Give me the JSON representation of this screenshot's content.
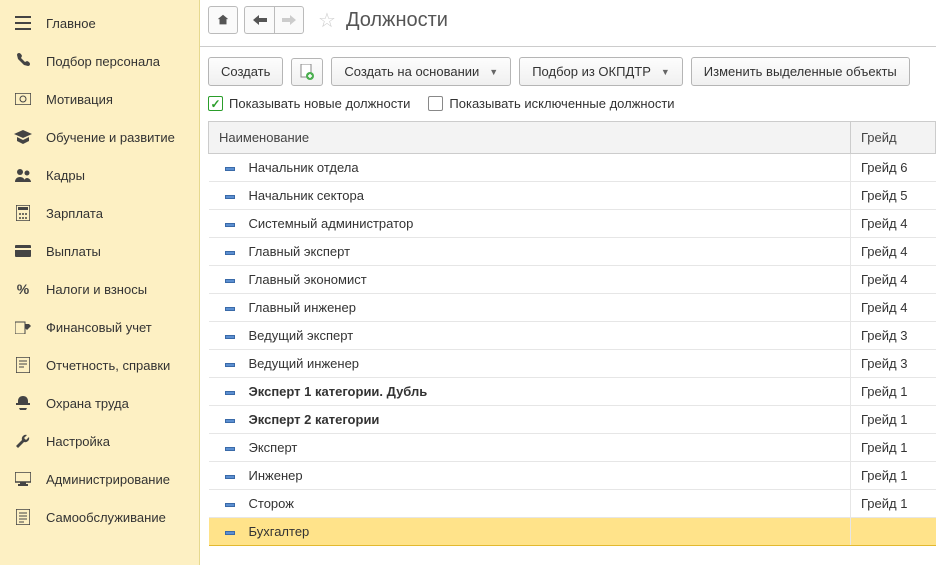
{
  "sidebar": {
    "items": [
      {
        "label": "Главное",
        "icon": "menu"
      },
      {
        "label": "Подбор персонала",
        "icon": "phone"
      },
      {
        "label": "Мотивация",
        "icon": "money"
      },
      {
        "label": "Обучение и развитие",
        "icon": "grad"
      },
      {
        "label": "Кадры",
        "icon": "users"
      },
      {
        "label": "Зарплата",
        "icon": "calc"
      },
      {
        "label": "Выплаты",
        "icon": "wallet"
      },
      {
        "label": "Налоги и взносы",
        "icon": "percent"
      },
      {
        "label": "Финансовый учет",
        "icon": "finance"
      },
      {
        "label": "Отчетность, справки",
        "icon": "report"
      },
      {
        "label": "Охрана труда",
        "icon": "safety"
      },
      {
        "label": "Настройка",
        "icon": "wrench"
      },
      {
        "label": "Администрирование",
        "icon": "admin"
      },
      {
        "label": "Самообслуживание",
        "icon": "self"
      }
    ]
  },
  "header": {
    "title": "Должности"
  },
  "toolbar": {
    "create": "Создать",
    "create_based": "Создать на основании",
    "pick": "Подбор из ОКПДТР",
    "change": "Изменить выделенные объекты"
  },
  "checkboxes": {
    "show_new": {
      "label": "Показывать новые должности",
      "checked": true
    },
    "show_excluded": {
      "label": "Показывать исключенные должности",
      "checked": false
    }
  },
  "table": {
    "columns": {
      "name": "Наименование",
      "grade": "Грейд"
    },
    "rows": [
      {
        "name": "Начальник отдела",
        "grade": "Грейд 6",
        "bold": false
      },
      {
        "name": "Начальник сектора",
        "grade": "Грейд 5",
        "bold": false
      },
      {
        "name": "Системный администратор",
        "grade": "Грейд 4",
        "bold": false
      },
      {
        "name": "Главный эксперт",
        "grade": "Грейд 4",
        "bold": false
      },
      {
        "name": "Главный экономист",
        "grade": "Грейд 4",
        "bold": false
      },
      {
        "name": "Главный инженер",
        "grade": "Грейд 4",
        "bold": false
      },
      {
        "name": "Ведущий эксперт",
        "grade": "Грейд 3",
        "bold": false
      },
      {
        "name": "Ведущий инженер",
        "grade": "Грейд 3",
        "bold": false
      },
      {
        "name": "Эксперт 1 категории. Дубль",
        "grade": "Грейд 1",
        "bold": true
      },
      {
        "name": "Эксперт 2 категории",
        "grade": "Грейд 1",
        "bold": true
      },
      {
        "name": "Эксперт",
        "grade": "Грейд 1",
        "bold": false
      },
      {
        "name": "Инженер",
        "grade": "Грейд 1",
        "bold": false
      },
      {
        "name": "Сторож",
        "grade": "Грейд 1",
        "bold": false
      },
      {
        "name": "Бухгалтер",
        "grade": "",
        "bold": false,
        "selected": true
      }
    ]
  }
}
